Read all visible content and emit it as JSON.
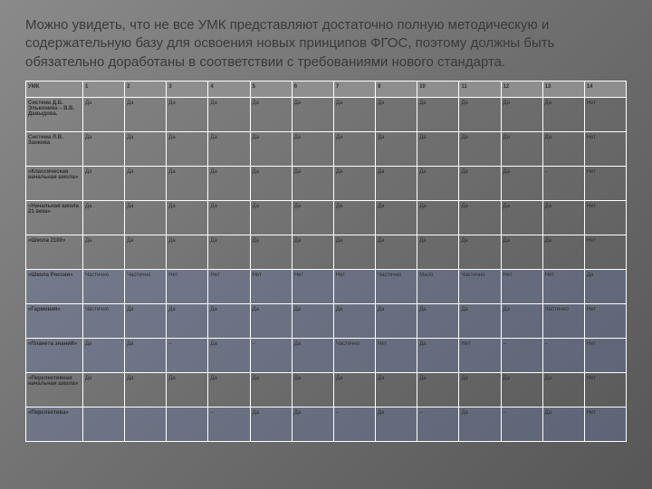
{
  "intro": "Можно увидеть, что не все УМК представляют достаточно полную методическую и содержательную базу для освоения новых принципов ФГОС, поэтому должны быть обязательно доработаны в соответствии с требованиями нового стандарта.",
  "columns": [
    "УМК",
    "1",
    "2",
    "3",
    "4",
    "5",
    "6",
    "7",
    "9",
    "10",
    "11",
    "12",
    "13",
    "14"
  ],
  "rows": [
    {
      "hl": false,
      "label": "Система Д.Б. Эльконина – В.В. Давыдова.",
      "cells": [
        "Да",
        "Да",
        "Да",
        "Да",
        "Да",
        "Да",
        "Да",
        "Да",
        "Да",
        "Да",
        "Да",
        "Да",
        "Нет"
      ]
    },
    {
      "hl": false,
      "label": "Система Л.В. Занкова",
      "cells": [
        "Да",
        "Да",
        "Да",
        "Да",
        "Да",
        "Да",
        "Да",
        "Да",
        "Да",
        "Да",
        "Да",
        "Да",
        "Нет"
      ]
    },
    {
      "hl": false,
      "label": "«Классическая начальная школа»",
      "cells": [
        "Да",
        "Да",
        "Да",
        "Да",
        "Да",
        "Да",
        "Да",
        "Да",
        "Да",
        "Да",
        "Да",
        "–",
        "Нет"
      ]
    },
    {
      "hl": false,
      "label": "«Начальная школа 21 века»",
      "cells": [
        "Да",
        "Да",
        "Да",
        "Да",
        "Да",
        "Да",
        "Да",
        "Да",
        "Да",
        "Да",
        "Да",
        "Да",
        "Нет"
      ]
    },
    {
      "hl": false,
      "label": "«Школа 2100»",
      "cells": [
        "Да",
        "Да",
        "Да",
        "Да",
        "Да",
        "Да",
        "Да",
        "Да",
        "Да",
        "Да",
        "Да",
        "Да",
        "Нет"
      ]
    },
    {
      "hl": true,
      "label": "«Школа России»",
      "cells": [
        "Частично",
        "Частично",
        "Нет",
        "Нет",
        "Нет",
        "Нет",
        "Нет",
        "Частично",
        "Мало",
        "Частично",
        "Нет",
        "Нет",
        "Да"
      ]
    },
    {
      "hl": true,
      "label": "«Гармония»",
      "cells": [
        "Частично",
        "Да",
        "Да",
        "Да",
        "Да",
        "Да",
        "Да",
        "Да",
        "Да",
        "Да",
        "Да",
        "Частично",
        "Нет"
      ]
    },
    {
      "hl": true,
      "label": "«Планета знаний»",
      "cells": [
        "Да",
        "Да",
        "–",
        "Да",
        "–",
        "Да",
        "Частично",
        "Нет",
        "Да",
        "Нет",
        "–",
        "–",
        "Нет"
      ]
    },
    {
      "hl": false,
      "label": "«Перспективная начальная школа»",
      "cells": [
        "Да",
        "Да",
        "Да",
        "Да",
        "Да",
        "Да",
        "Да",
        "Да",
        "Да",
        "Да",
        "Да",
        "Да",
        "Нет"
      ]
    },
    {
      "hl": true,
      "label": "«Перспектива»",
      "cells": [
        "",
        "",
        "",
        "–",
        "Да",
        "Да",
        "–",
        "Да",
        "–",
        "Да",
        "–",
        "Да",
        "Нет"
      ]
    }
  ],
  "chart_data": {
    "type": "table",
    "title": "Сравнение УМК по критериям",
    "columns": [
      "УМК",
      "1",
      "2",
      "3",
      "4",
      "5",
      "6",
      "7",
      "9",
      "10",
      "11",
      "12",
      "13",
      "14"
    ],
    "data": [
      [
        "Система Д.Б. Эльконина – В.В. Давыдова.",
        "Да",
        "Да",
        "Да",
        "Да",
        "Да",
        "Да",
        "Да",
        "Да",
        "Да",
        "Да",
        "Да",
        "Да",
        "Нет"
      ],
      [
        "Система Л.В. Занкова",
        "Да",
        "Да",
        "Да",
        "Да",
        "Да",
        "Да",
        "Да",
        "Да",
        "Да",
        "Да",
        "Да",
        "Да",
        "Нет"
      ],
      [
        "«Классическая начальная школа»",
        "Да",
        "Да",
        "Да",
        "Да",
        "Да",
        "Да",
        "Да",
        "Да",
        "Да",
        "Да",
        "Да",
        "–",
        "Нет"
      ],
      [
        "«Начальная школа 21 века»",
        "Да",
        "Да",
        "Да",
        "Да",
        "Да",
        "Да",
        "Да",
        "Да",
        "Да",
        "Да",
        "Да",
        "Да",
        "Нет"
      ],
      [
        "«Школа 2100»",
        "Да",
        "Да",
        "Да",
        "Да",
        "Да",
        "Да",
        "Да",
        "Да",
        "Да",
        "Да",
        "Да",
        "Да",
        "Нет"
      ],
      [
        "«Школа России»",
        "Частично",
        "Частично",
        "Нет",
        "Нет",
        "Нет",
        "Нет",
        "Нет",
        "Частично",
        "Мало",
        "Частично",
        "Нет",
        "Нет",
        "Да"
      ],
      [
        "«Гармония»",
        "Частично",
        "Да",
        "Да",
        "Да",
        "Да",
        "Да",
        "Да",
        "Да",
        "Да",
        "Да",
        "Да",
        "Частично",
        "Нет"
      ],
      [
        "«Планета знаний»",
        "Да",
        "Да",
        "–",
        "Да",
        "–",
        "Да",
        "Частично",
        "Нет",
        "Да",
        "Нет",
        "–",
        "–",
        "Нет"
      ],
      [
        "«Перспективная начальная школа»",
        "Да",
        "Да",
        "Да",
        "Да",
        "Да",
        "Да",
        "Да",
        "Да",
        "Да",
        "Да",
        "Да",
        "Да",
        "Нет"
      ],
      [
        "«Перспектива»",
        "",
        "",
        "",
        "–",
        "Да",
        "Да",
        "–",
        "Да",
        "–",
        "Да",
        "–",
        "Да",
        "Нет"
      ]
    ]
  }
}
